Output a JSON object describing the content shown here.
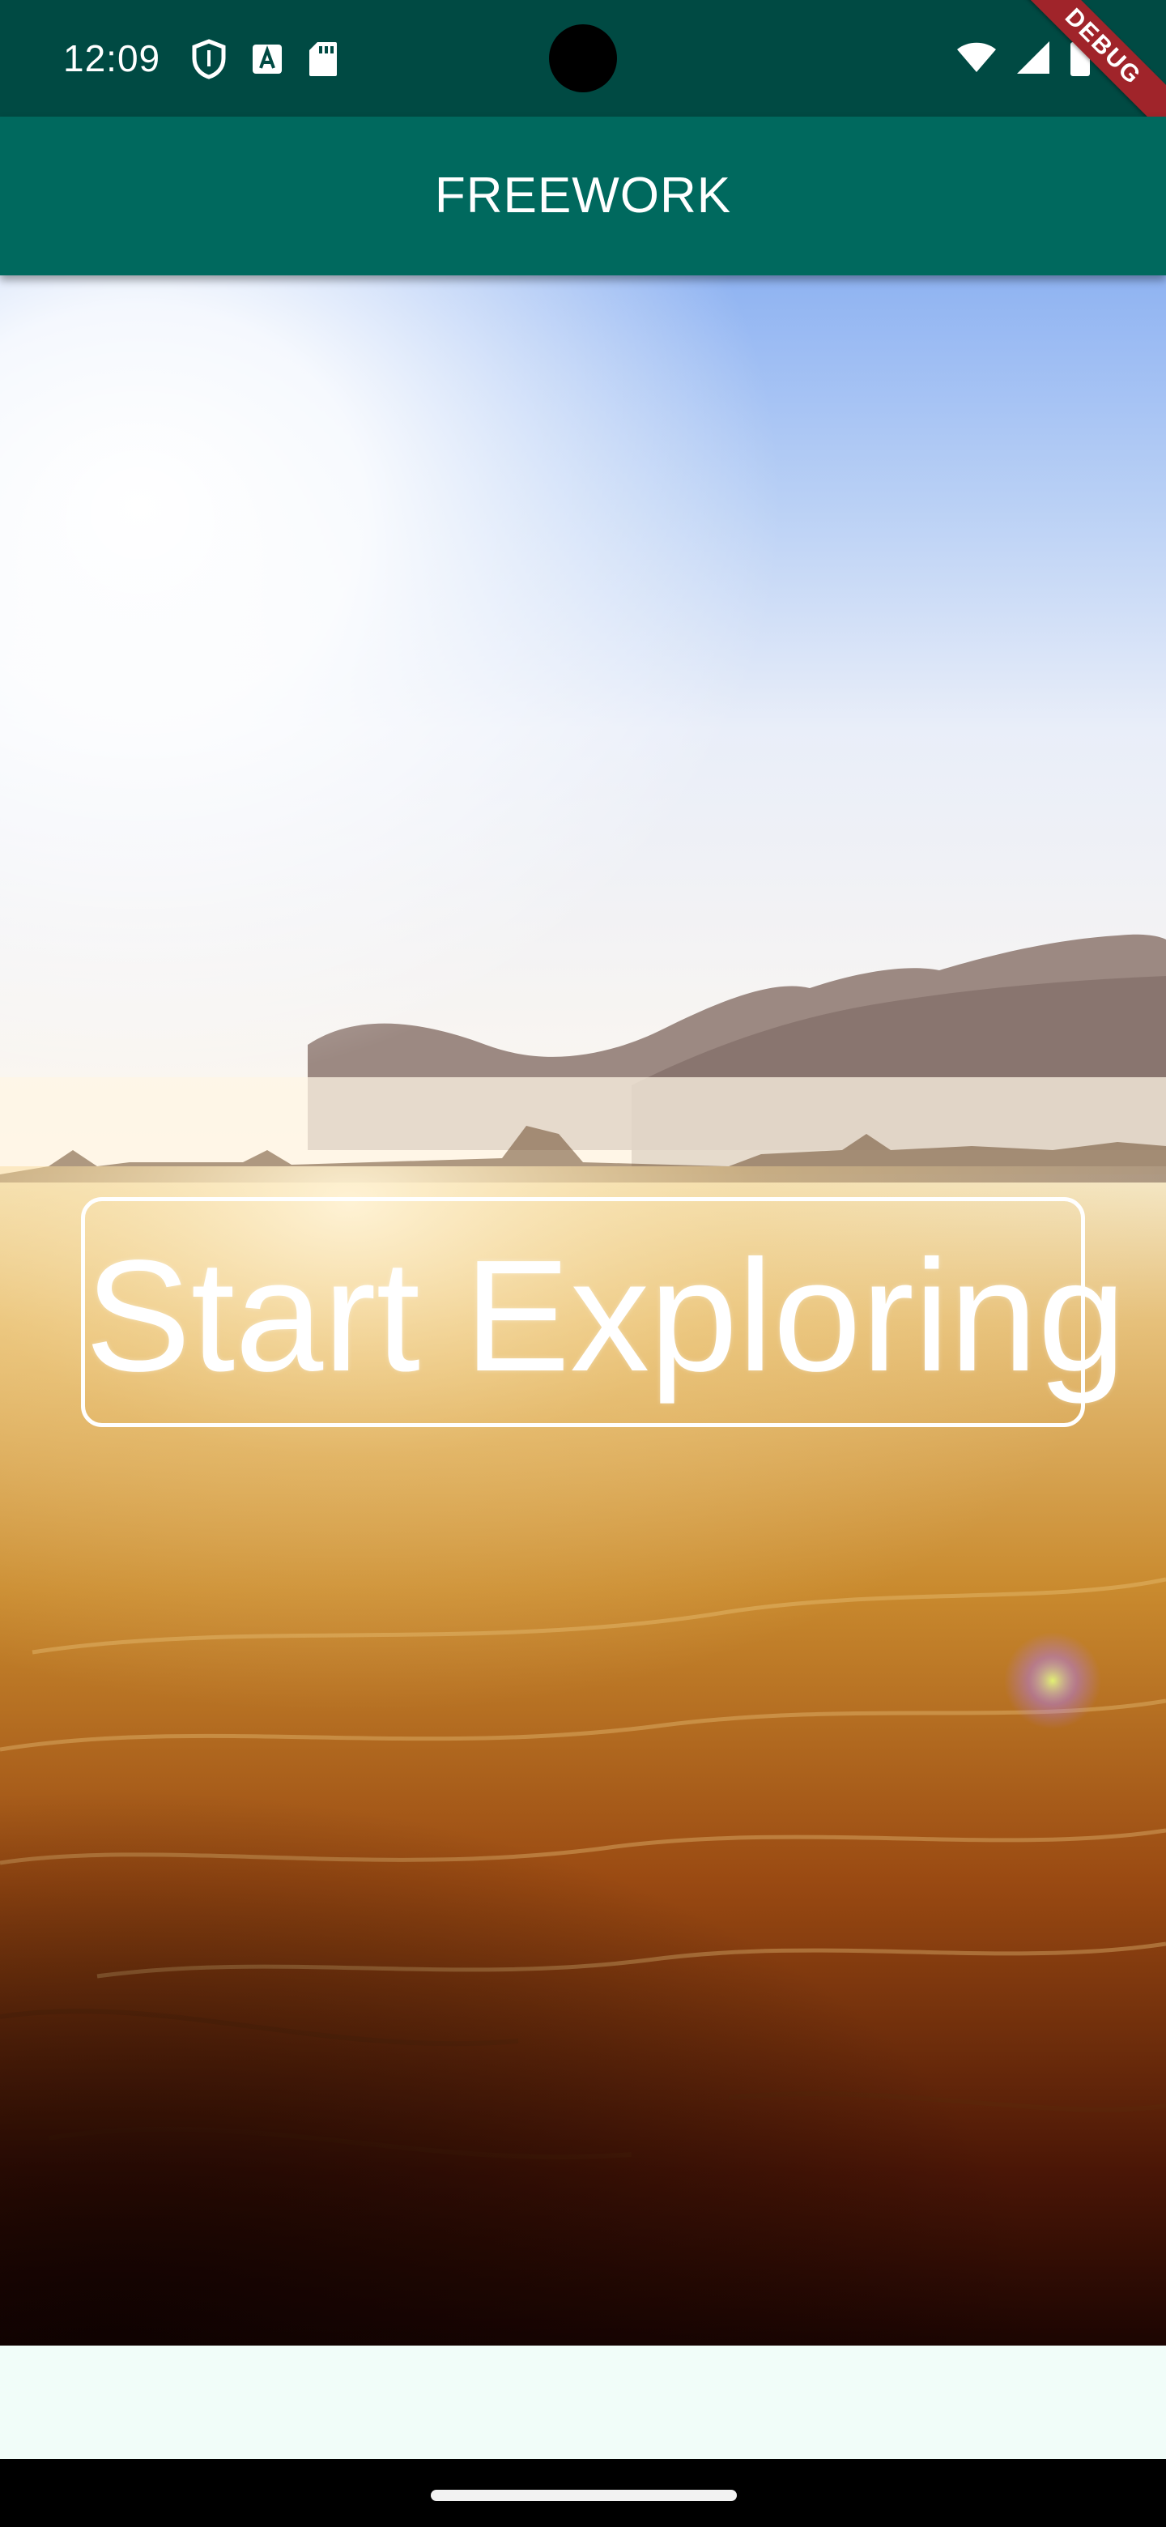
{
  "status_bar": {
    "time": "12:09",
    "left_icons": [
      "shield-icon",
      "font-a-icon",
      "sd-card-icon"
    ],
    "right_icons": [
      "wifi-icon",
      "cellular-signal-icon",
      "battery-icon"
    ],
    "debug_label": "DEBUG"
  },
  "app_bar": {
    "title": "FREEWORK"
  },
  "main": {
    "background": "sunrise-meadow-video",
    "explore_button_label": "Start Exploring"
  },
  "colors": {
    "status_bar": "#004a43",
    "app_bar": "#00695e",
    "bottom_area": "#f1fdf9",
    "debug_banner": "#a0242a"
  }
}
